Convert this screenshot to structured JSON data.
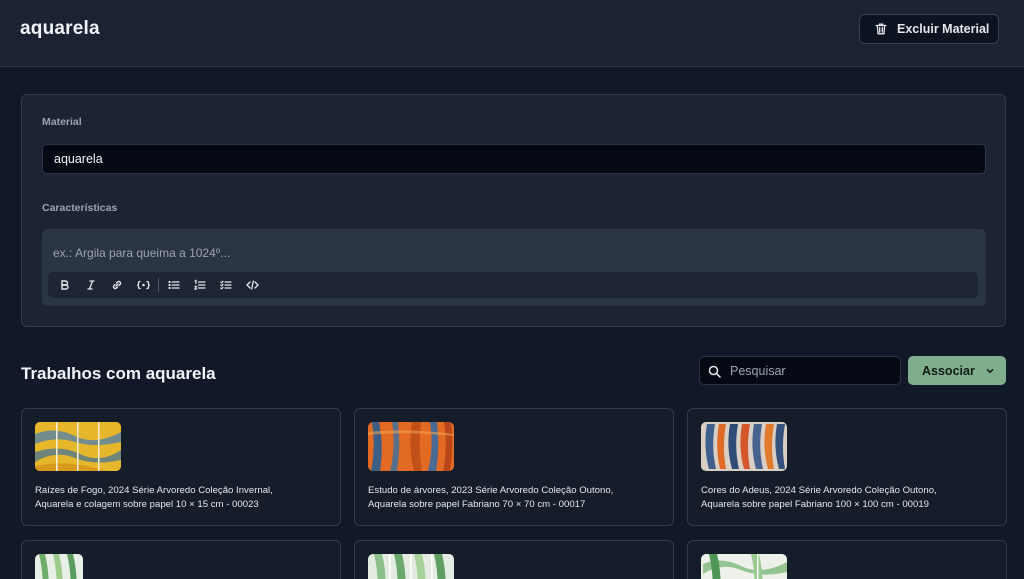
{
  "header": {
    "title": "aquarela",
    "delete_label": "Excluir Material"
  },
  "form": {
    "material_label": "Material",
    "material_value": "aquarela",
    "features_label": "Características",
    "features_placeholder": "ex.: Argila para queima a 1024º..."
  },
  "works": {
    "title": "Trabalhos com aquarela",
    "search_placeholder": "Pesquisar",
    "associate_label": "Associar",
    "cards": [
      {
        "line1": "Raízes de Fogo, 2024 Série Arvoredo Coleção Invernal,",
        "line2": "Aquarela e colagem sobre papel 10 × 15 cm - 00023"
      },
      {
        "line1": "Estudo de árvores, 2023 Série Arvoredo Coleção Outono,",
        "line2": "Aquarela sobre papel Fabriano 70 × 70 cm - 00017"
      },
      {
        "line1": "Cores do Adeus, 2024 Série Arvoredo Coleção Outono,",
        "line2": "Aquarela sobre papel Fabriano 100 × 100 cm - 00019"
      }
    ]
  },
  "colors": {
    "background": "#111827",
    "accent": "#7fae8c"
  }
}
